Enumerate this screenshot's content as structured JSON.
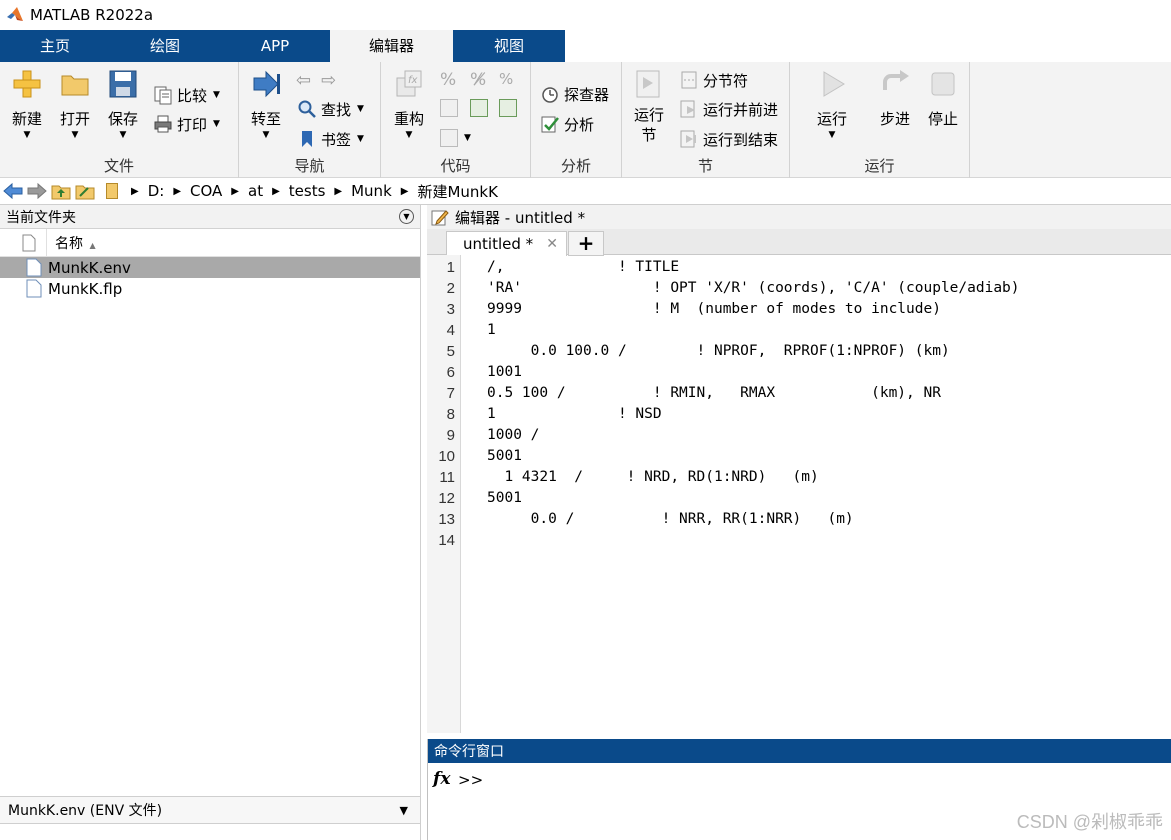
{
  "window": {
    "title": "MATLAB R2022a"
  },
  "ribbon_tabs": [
    "主页",
    "绘图",
    "APP",
    "编辑器",
    "视图"
  ],
  "ribbon": {
    "file_group": {
      "label": "文件",
      "new": "新建",
      "open": "打开",
      "save": "保存",
      "compare": "比较",
      "print": "打印"
    },
    "nav_group": {
      "label": "导航",
      "goto": "转至",
      "find": "查找",
      "bookmark": "书签"
    },
    "code_group": {
      "label": "代码",
      "refactor": "重构"
    },
    "analyze_group": {
      "label": "分析",
      "explorer": "探查器",
      "analyze": "分析"
    },
    "section_group": {
      "label": "节",
      "run_section_1": "运行",
      "run_section_2": "节",
      "section_break": "分节符",
      "run_and_advance": "运行并前进",
      "run_to_end": "运行到结束"
    },
    "run_group": {
      "label": "运行",
      "run": "运行",
      "step": "步进",
      "stop": "停止"
    }
  },
  "address": {
    "crumbs": [
      "D:",
      "COA",
      "at",
      "tests",
      "Munk",
      "新建MunkK"
    ]
  },
  "file_browser": {
    "title": "当前文件夹",
    "column_name": "名称",
    "files": [
      {
        "name": "MunkK.env",
        "selected": true
      },
      {
        "name": "MunkK.flp",
        "selected": false
      }
    ],
    "details_label": "MunkK.env  (ENV 文件)"
  },
  "editor": {
    "header": "编辑器 - untitled *",
    "tab_label": "untitled *",
    "lines": [
      "/,             ! TITLE",
      "'RA'               ! OPT 'X/R' (coords), 'C/A' (couple/adiab)",
      "9999               ! M  (number of modes to include)",
      "1",
      "     0.0 100.0 /        ! NPROF,  RPROF(1:NPROF) (km)",
      "1001",
      "0.5 100 /          ! RMIN,   RMAX           (km), NR",
      "1              ! NSD",
      "1000 /",
      "5001",
      "  1 4321  /     ! NRD, RD(1:NRD)   (m)",
      "5001",
      "     0.0 /          ! NRR, RR(1:NRR)   (m)",
      ""
    ]
  },
  "command_window": {
    "title": "命令行窗口",
    "prompt": ">>",
    "fx": "fx"
  },
  "watermark": "CSDN @剁椒乖乖",
  "colors": {
    "accent": "#0a4a8a",
    "selection": "#a9a9a9",
    "ribbon_bg": "#f3f3f3"
  }
}
